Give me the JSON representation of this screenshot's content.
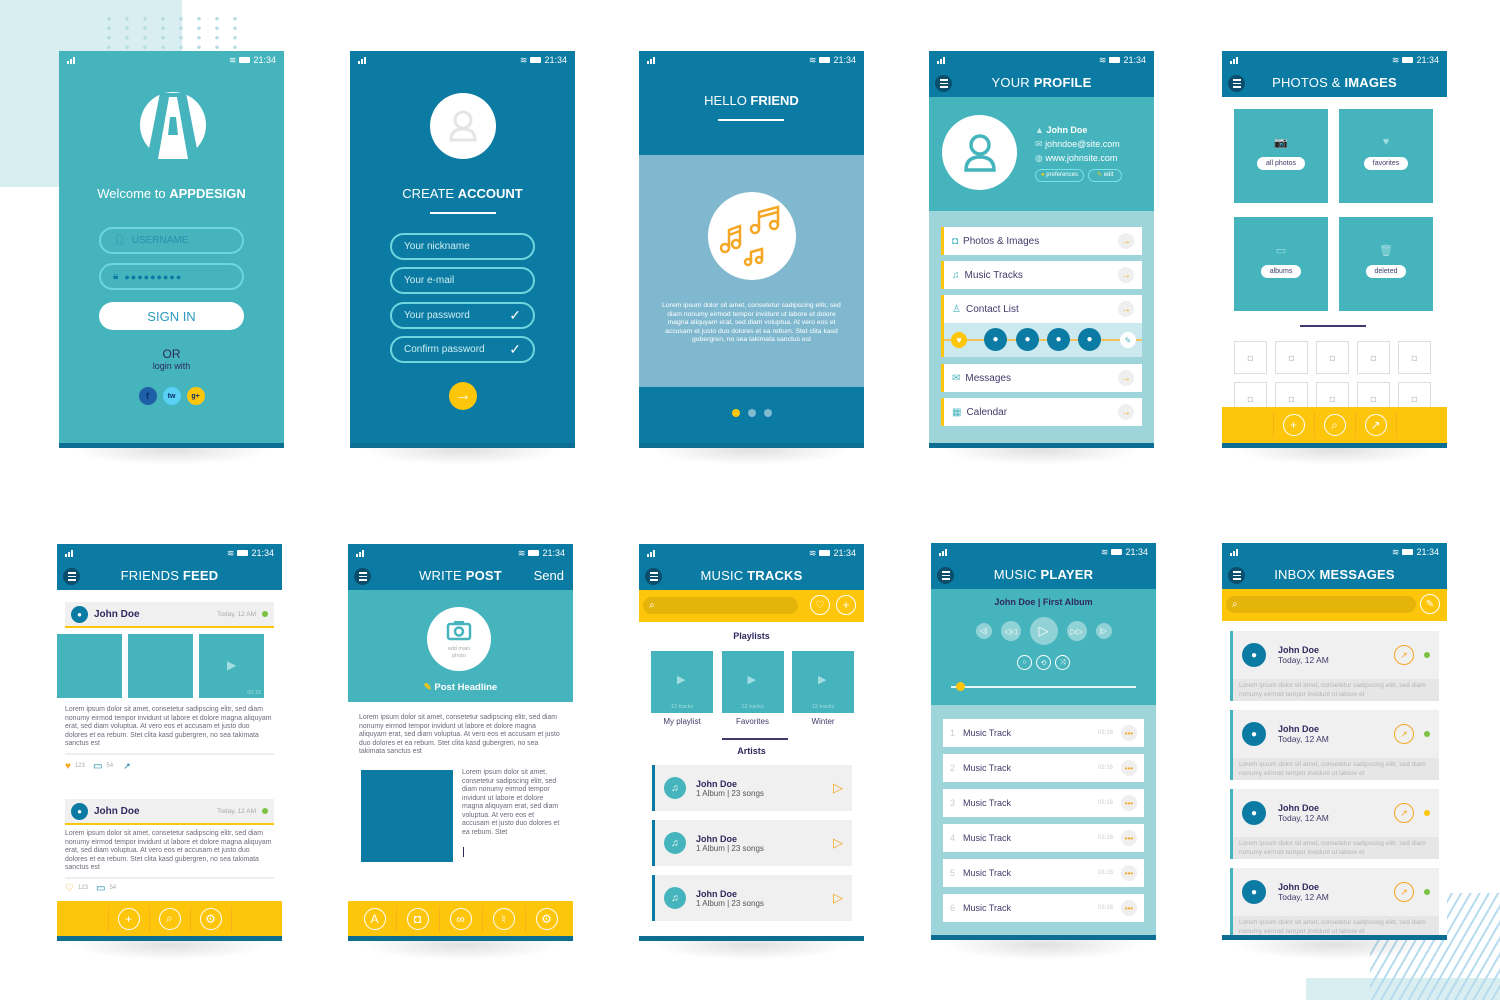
{
  "status": {
    "time": "21:34"
  },
  "colors": {
    "teal": "#45b4bd",
    "blue": "#0b7ba3",
    "yellow": "#fec60a",
    "orange": "#f5a623",
    "navy": "#2e2a5e",
    "green": "#7cc242"
  },
  "login": {
    "logo_icon": "letter-a-logo",
    "welcome_prefix": "Welcome to ",
    "welcome_brand": "APPDESIGN",
    "username_placeholder": "USERNAME",
    "password_value": "●●●●●●●●●",
    "sign_in": "SIGN IN",
    "or": "OR",
    "login_with": "login with",
    "socials": [
      {
        "label": "f",
        "icon": "facebook-icon",
        "color": "#1f5fa8"
      },
      {
        "label": "tw",
        "icon": "twitter-icon",
        "color": "#5bd0f5"
      },
      {
        "label": "g+",
        "icon": "google-plus-icon",
        "color": "#fec60a"
      }
    ]
  },
  "create_account": {
    "title_light": "CREATE ",
    "title_bold": "ACCOUNT",
    "fields": [
      {
        "placeholder": "Your nickname",
        "checked": false
      },
      {
        "placeholder": "Your e-mail",
        "checked": false
      },
      {
        "placeholder": "Your password",
        "checked": true
      },
      {
        "placeholder": "Confirm password",
        "checked": true
      }
    ],
    "next_icon": "arrow-right-icon"
  },
  "hello": {
    "title_light": "HELLO ",
    "title_bold": "FRIEND",
    "body": "Lorem ipsum dolor sit amet, consetetur sadipscing elitr, sed diam nonumy eirmod tempor invidunt ut labore et dolore magna aliquyam erat, sed diam voluptua. At vero eos et accusam et justo duo dolores et ea rebum. Stet clita kasd gubergren, no sea takimata sanctus est",
    "pages": 3,
    "active_page": 1
  },
  "profile": {
    "title_light": "YOUR ",
    "title_bold": "PROFILE",
    "name": "John Doe",
    "email": "johndoe@site.com",
    "website": "www.johnsite.com",
    "preferences": "preferences",
    "edit": "edit",
    "menu": [
      {
        "label": "Photos & Images",
        "icon": "camera-icon"
      },
      {
        "label": "Music Tracks",
        "icon": "music-note-icon"
      },
      {
        "label": "Contact List",
        "icon": "user-icon"
      },
      {
        "label": "Messages",
        "icon": "envelope-icon"
      },
      {
        "label": "Calendar",
        "icon": "calendar-icon"
      }
    ],
    "contacts_count": 4
  },
  "photos": {
    "title_light": "PHOTOS & ",
    "title_bold": "IMAGES",
    "categories": [
      {
        "label": "all photos",
        "icon": "camera-icon",
        "glyph": "📷"
      },
      {
        "label": "favorites",
        "icon": "heart-icon",
        "glyph": "♥"
      },
      {
        "label": "albums",
        "icon": "albums-icon",
        "glyph": "▭"
      },
      {
        "label": "deleted",
        "icon": "trash-icon",
        "glyph": "🗑"
      }
    ],
    "thumbnails": 10,
    "toolbar": [
      {
        "icon": "plus-icon",
        "glyph": "+"
      },
      {
        "icon": "search-icon",
        "glyph": "⌕"
      },
      {
        "icon": "share-icon",
        "glyph": "↗"
      }
    ]
  },
  "feed": {
    "title_light": "FRIENDS ",
    "title_bold": "FEED",
    "posts": [
      {
        "author": "John Doe",
        "time": "Today, 12 AM",
        "has_media": true,
        "video_duration": "00:15",
        "body": "Lorem ipsum dolor sit amet, consetetur sadipscing elitr, sed diam nonumy eirmod tempor invidunt ut labore et dolore magna aliquyam erat, sed diam voluptua. At vero eos et accusam et justo duo dolores et ea rebum. Stet clita kasd gubergren, no sea takimata sanctus est",
        "likes": "123",
        "comments": "54"
      },
      {
        "author": "John Doe",
        "time": "Today, 12 AM",
        "has_media": false,
        "body": "Lorem ipsum dolor sit amet, consetetur sadipscing elitr, sed diam nonumy eirmod tempor invidunt ut labore et dolore magna aliquyam erat, sed diam voluptua. At vero eos et accusam et justo duo dolores et ea rebum. Stet clita kasd gubergren, no sea takimata sanctus est",
        "likes": "123",
        "comments": "54"
      }
    ],
    "toolbar": [
      {
        "icon": "plus-icon",
        "glyph": "+"
      },
      {
        "icon": "search-icon",
        "glyph": "⌕"
      },
      {
        "icon": "gear-icon",
        "glyph": "⚙"
      }
    ]
  },
  "write": {
    "title_light": "WRITE ",
    "title_bold": "POST",
    "send": "Send",
    "add_photo": "add main photo",
    "headline": "Post Headline",
    "body": "Lorem ipsum dolor sit amet, consetetur sadipscing elitr, sed diam nonumy eirmod tempor invidunt ut labore et dolore magna aliquyam erat, sed diam voluptua. At vero eos et accusam et justo duo dolores et ea rebum. Stet clita kasd gubergren, no sea takimata sanctus est",
    "side_text": "Lorem ipsum dolor sit amet, consetetur sadipscing elitr, sed diam nonumy eirmod tempor invidunt ut labore et dolore magna aliquyam erat, sed diam voluptua. At vero eos et accusam et justo duo dolores et ea rebum. Stet",
    "toolbar": [
      {
        "icon": "font-icon",
        "glyph": "A"
      },
      {
        "icon": "camera-icon",
        "glyph": "◘"
      },
      {
        "icon": "link-icon",
        "glyph": "∞"
      },
      {
        "icon": "microphone-icon",
        "glyph": "♮"
      },
      {
        "icon": "gear-icon",
        "glyph": "⚙"
      }
    ]
  },
  "tracks": {
    "title_light": "MUSIC ",
    "title_bold": "TRACKS",
    "search_placeholder": "",
    "playlists_heading": "Playlists",
    "playlists": [
      {
        "name": "My playlist",
        "count": "12 tracks"
      },
      {
        "name": "Favorites",
        "count": "12 tracks"
      },
      {
        "name": "Winter",
        "count": "12 tracks"
      }
    ],
    "active_playlist": 1,
    "artists_heading": "Artists",
    "artists": [
      {
        "name": "John Doe",
        "meta": "1 Album | 23 songs"
      },
      {
        "name": "John Doe",
        "meta": "1 Album | 23 songs"
      },
      {
        "name": "John Doe",
        "meta": "1 Album | 23 songs"
      }
    ]
  },
  "player": {
    "title_light": "MUSIC ",
    "title_bold": "PLAYER",
    "now_playing": "John Doe | First Album",
    "progress": 0.05,
    "tracks": [
      {
        "num": "1",
        "title": "Music Track",
        "duration": "03:16"
      },
      {
        "num": "2",
        "title": "Music Track",
        "duration": "03:16"
      },
      {
        "num": "3",
        "title": "Music Track",
        "duration": "03:16"
      },
      {
        "num": "4",
        "title": "Music Track",
        "duration": "03:16"
      },
      {
        "num": "5",
        "title": "Music Track",
        "duration": "03:16"
      },
      {
        "num": "6",
        "title": "Music Track",
        "duration": "03:16"
      }
    ]
  },
  "inbox": {
    "title_light": "INBOX ",
    "title_bold": "MESSAGES",
    "messages": [
      {
        "author": "John Doe",
        "time": "Today, 12 AM",
        "preview": "Lorem ipsum dolor sit amet, consetetur sadipscing elitr, sed diam nonumy eirmod tempor invidunt ut labore et",
        "status_color": "#7cc242"
      },
      {
        "author": "John Doe",
        "time": "Today, 12 AM",
        "preview": "Lorem ipsum dolor sit amet, consetetur sadipscing elitr, sed diam nonumy eirmod tempor invidunt ut labore et",
        "status_color": "#7cc242"
      },
      {
        "author": "John Doe",
        "time": "Today, 12 AM",
        "preview": "Lorem ipsum dolor sit amet, consetetur sadipscing elitr, sed diam nonumy eirmod tempor invidunt ut labore et",
        "status_color": "#fec60a"
      },
      {
        "author": "John Doe",
        "time": "Today, 12 AM",
        "preview": "Lorem ipsum dolor sit amet, consetetur sadipscing elitr, sed diam nonumy eirmod tempor invidunt ut labore et",
        "status_color": "#7cc242"
      }
    ]
  }
}
